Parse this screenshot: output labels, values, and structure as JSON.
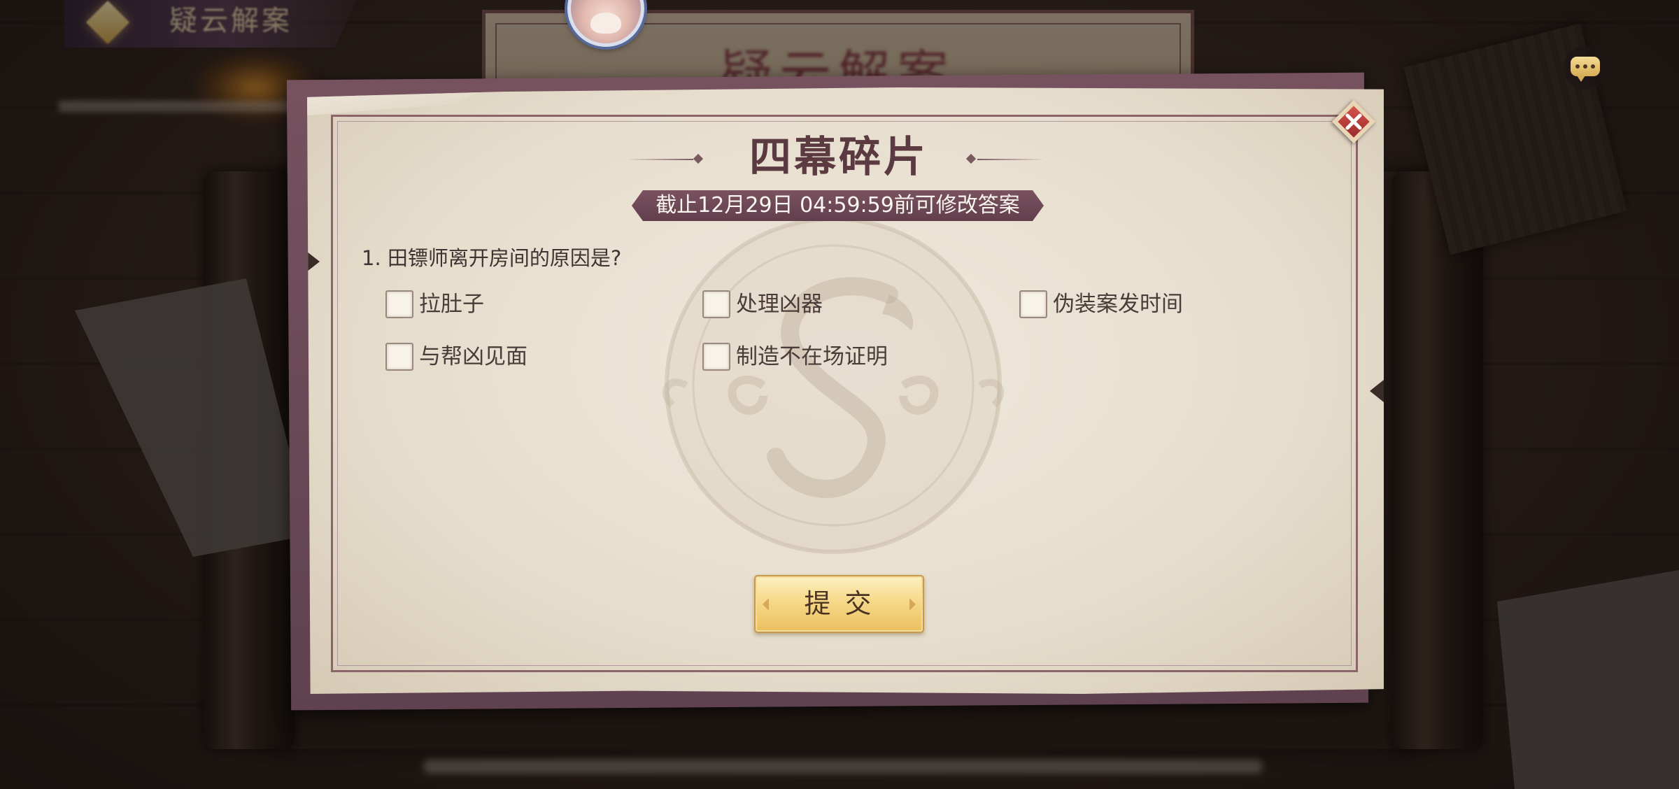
{
  "colors": {
    "accent_maroon": "#6e4853",
    "title_text": "#5b3a41",
    "paper": "#e9e2d4",
    "submit_gold": "#f3cf74",
    "close_red": "#b8393a"
  },
  "background": {
    "banner_title": "疑云解案",
    "plate_title": "疑云解案",
    "banner_emblem_icon": "gold-diamond-emblem-icon"
  },
  "top_bar": {
    "avatar_icon": "character-avatar-icon",
    "chat_icon": "chat-bubble-icon"
  },
  "modal": {
    "title": "四幕碎片",
    "deadline": "截止12月29日 04:59:59前可修改答案",
    "question": {
      "text": "1. 田镖师离开房间的原因是?",
      "options": [
        {
          "label": "拉肚子",
          "checked": false
        },
        {
          "label": "处理凶器",
          "checked": false
        },
        {
          "label": "伪装案发时间",
          "checked": false
        },
        {
          "label": "与帮凶见面",
          "checked": false
        },
        {
          "label": "制造不在场证明",
          "checked": false
        }
      ]
    },
    "submit_label": "提 交",
    "close_icon": "close-icon",
    "watermark_icon": "dragon-emblem-icon"
  }
}
